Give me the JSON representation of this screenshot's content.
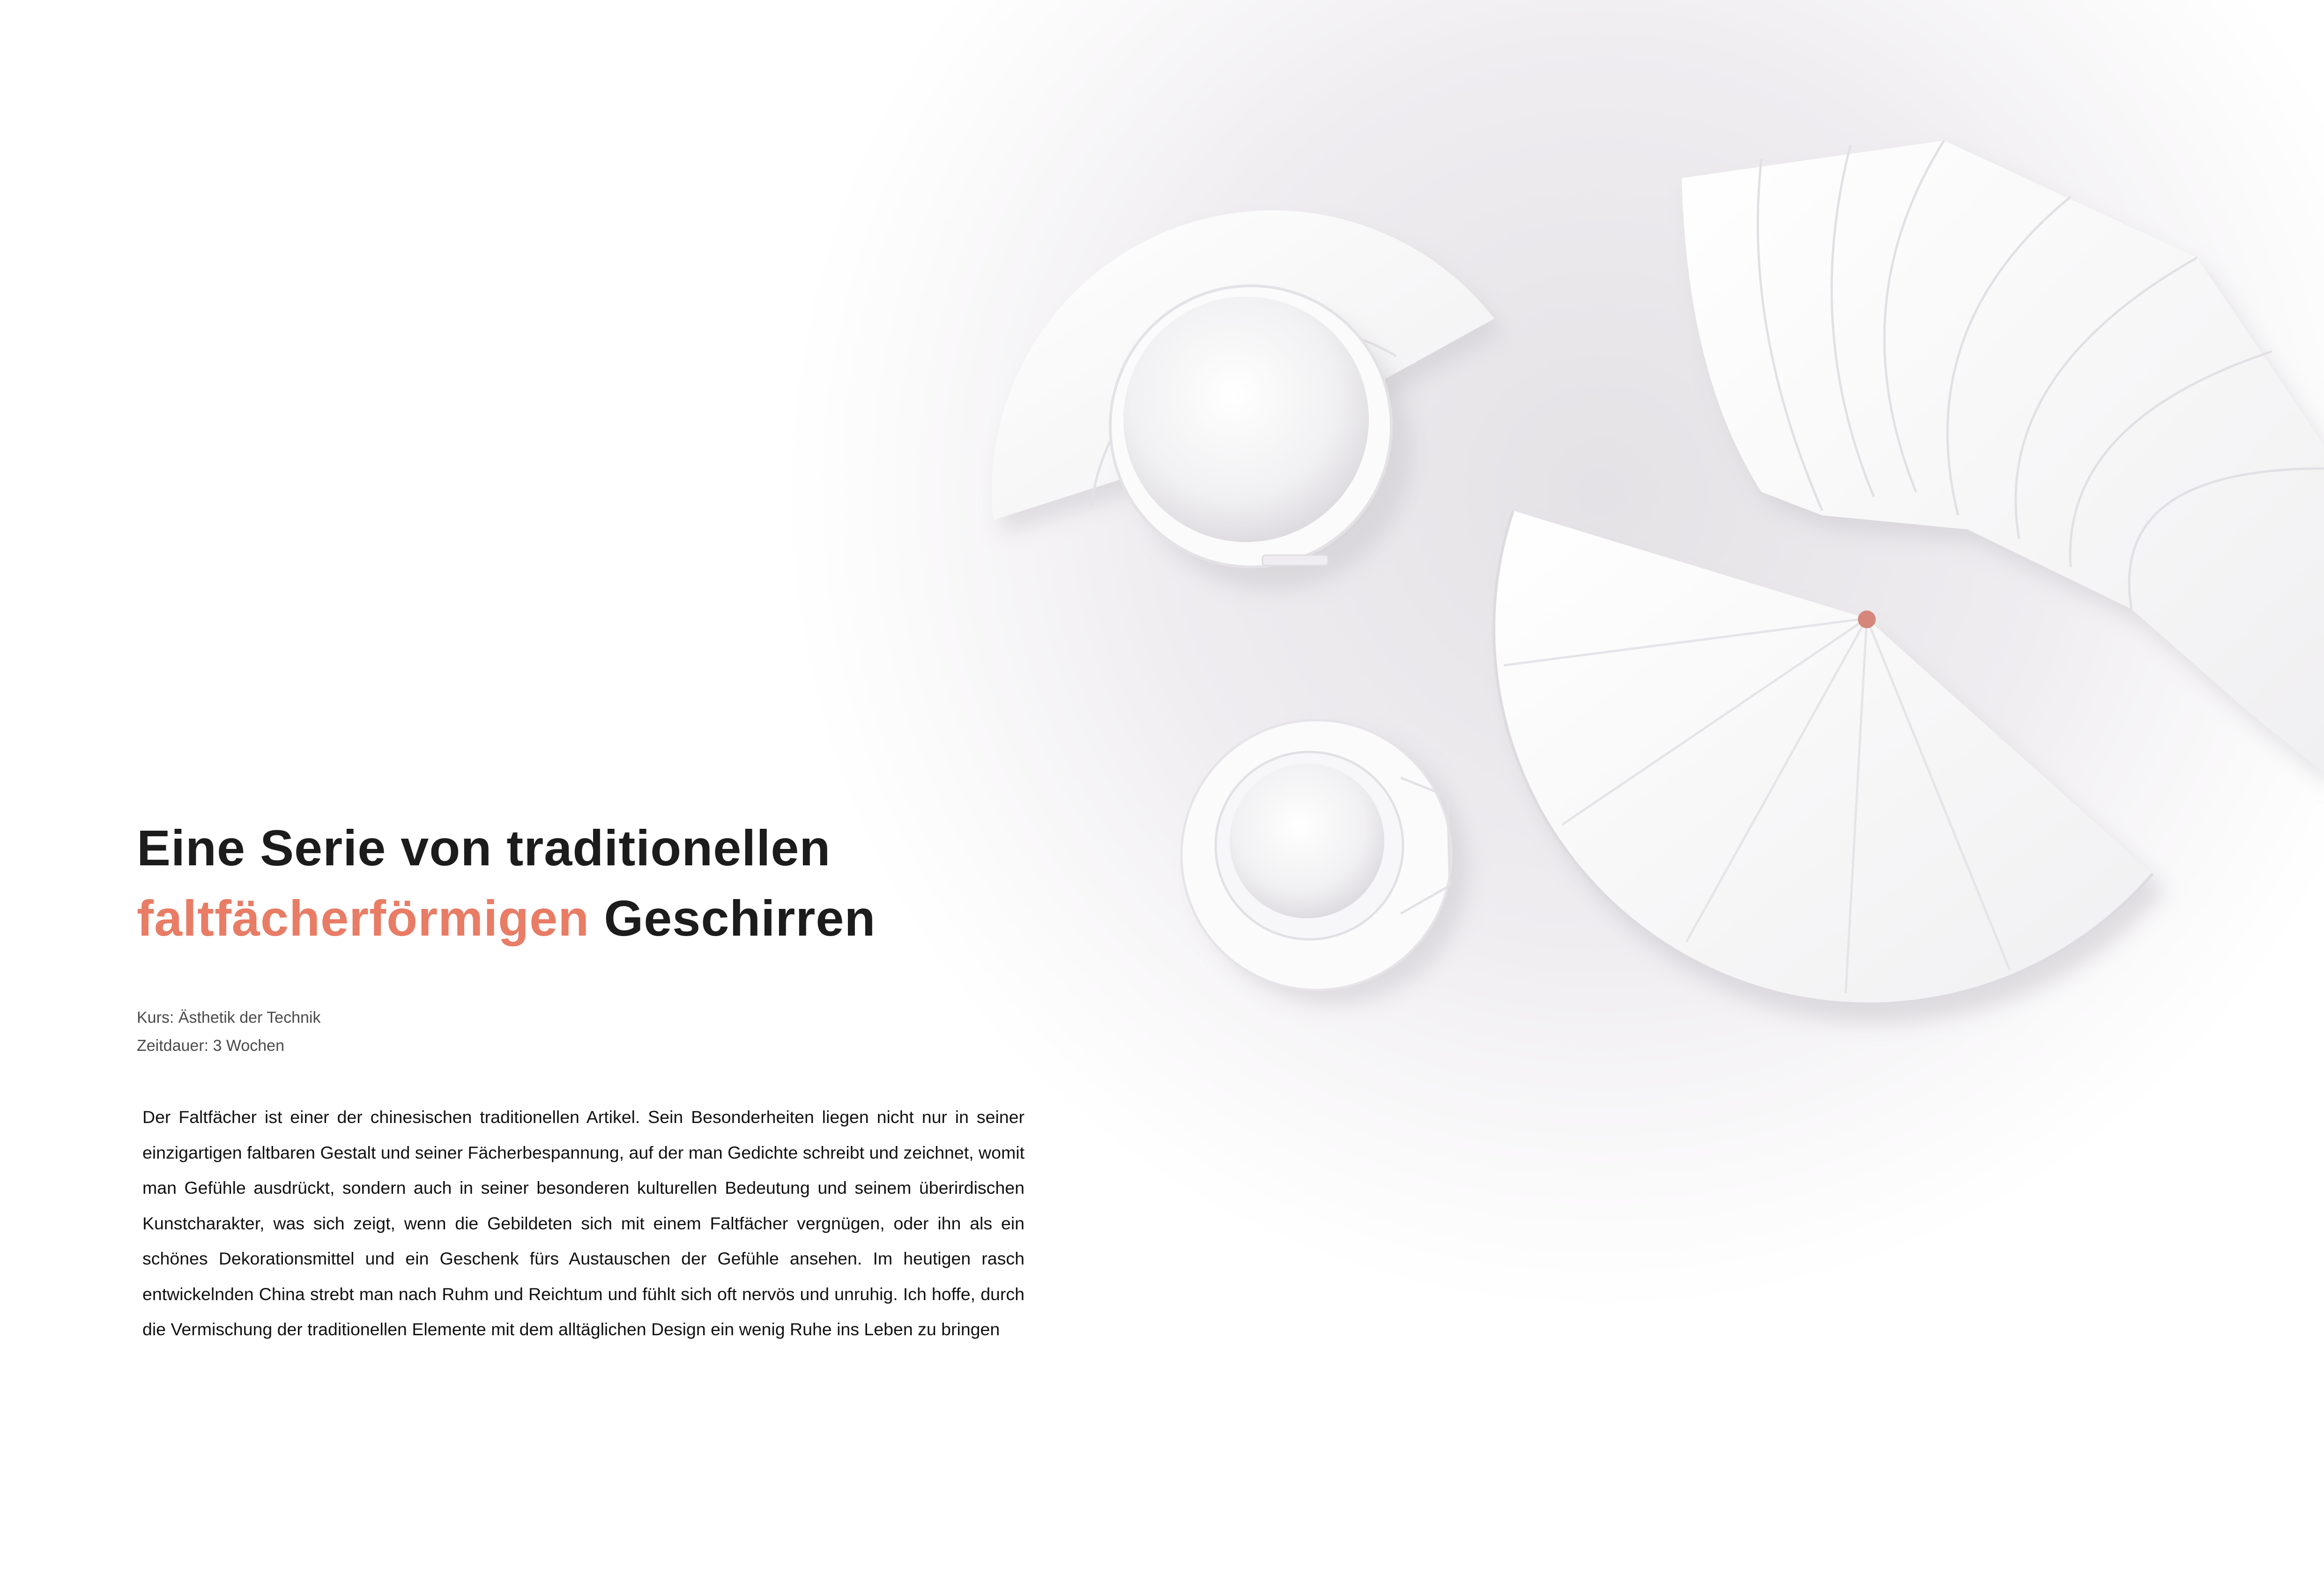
{
  "title": {
    "line1": "Eine Serie von traditionellen",
    "line2_accent": "faltfächerförmigen",
    "line2_rest": "Geschirren"
  },
  "meta": {
    "course": "Kurs: Ästhetik der Technik",
    "duration": "Zeitdauer: 3 Wochen"
  },
  "body": {
    "paragraph": "Der Faltfächer ist einer der chinesischen traditionellen Artikel. Sein Besonderheiten liegen nicht nur in seiner einzigartigen faltbaren Gestalt und seiner Fächerbespannung, auf der man Gedichte schreibt und zeichnet, womit man Gefühle ausdrückt, sondern auch in seiner besonderen kulturellen Bedeutung und seinem überirdischen Kunstcharakter, was sich zeigt, wenn die Gebildeten sich mit einem Faltfächer vergnügen, oder ihn als ein schönes Dekorationsmittel und ein Geschenk fürs Austauschen der Gefühle ansehen. Im heutigen rasch entwickelnden China strebt man nach Ruhm und Reichtum und fühlt sich oft nervös und unruhig. Ich hoffe, durch die Vermischung der traditionellen Elemente mit dem alltäglichen Design ein wenig Ruhe ins Leben zu bringen"
  },
  "colors": {
    "accent": "#e87c65",
    "heading": "#1c1c1c",
    "background": "#ffffff",
    "pin": "#d4877a"
  }
}
